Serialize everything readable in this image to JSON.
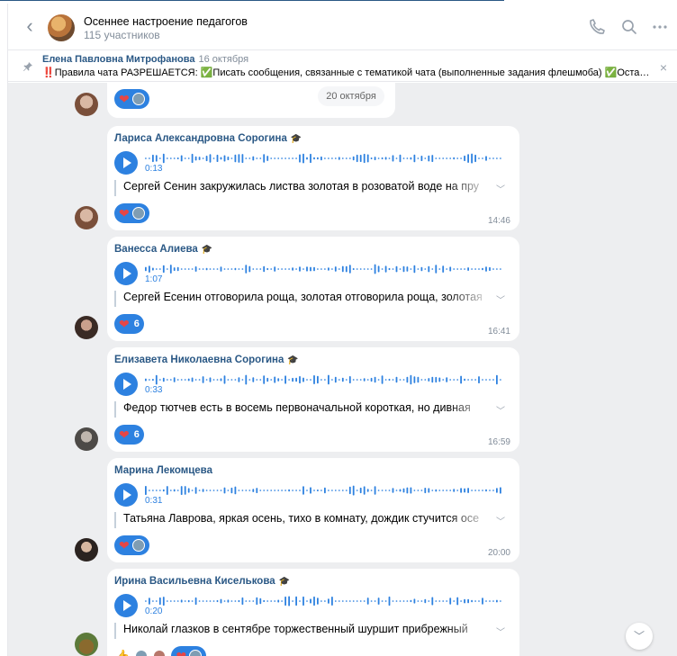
{
  "header": {
    "back": "‹",
    "title": "Осеннее настроение педагогов",
    "subtitle": "115 участников"
  },
  "pinned": {
    "author": "Елена Павловна Митрофанова",
    "date": "16 октября",
    "text": "‼️Правила чата РАЗРЕШАЕТСЯ: ✅Писать сообщения, связанные с тематикой чата (выполненные задания флешмоба) ✅Оставлять реа...",
    "close": "×"
  },
  "first_bubble": {
    "date_pill": "20 октября"
  },
  "messages": [
    {
      "author": "Лариса Александровна Сорогина",
      "duration": "0:13",
      "transcript": "Сергей Сенин закружилась листва золотая в розоватой воде на пру",
      "reaction_count": "",
      "time": "14:46"
    },
    {
      "author": "Ванесса Алиева",
      "duration": "1:07",
      "transcript": "Сергей Есенин отговорила роща, золотая отговорила роща, золотая",
      "reaction_count": "6",
      "time": "16:41"
    },
    {
      "author": "Елизавета Николаевна Сорогина",
      "duration": "0:33",
      "transcript": "Федор тютчев есть в восемь первоначальной короткая, но дивная",
      "reaction_count": "6",
      "time": "16:59"
    },
    {
      "author": "Марина Лекомцева",
      "duration": "0:31",
      "transcript": "Татьяна Лаврова, яркая осень, тихо в комнату, дождик стучится осе",
      "reaction_count": "",
      "time": "20:00"
    },
    {
      "author": "Ирина Васильевна Киселькова",
      "duration": "0:20",
      "transcript": "Николай глазков в сентябре торжественный шуршит прибрежный",
      "reaction_count": "",
      "time": ""
    }
  ],
  "colors": {
    "accent": "#2d81e0",
    "link": "#2a5885",
    "bg": "#edeef0"
  }
}
